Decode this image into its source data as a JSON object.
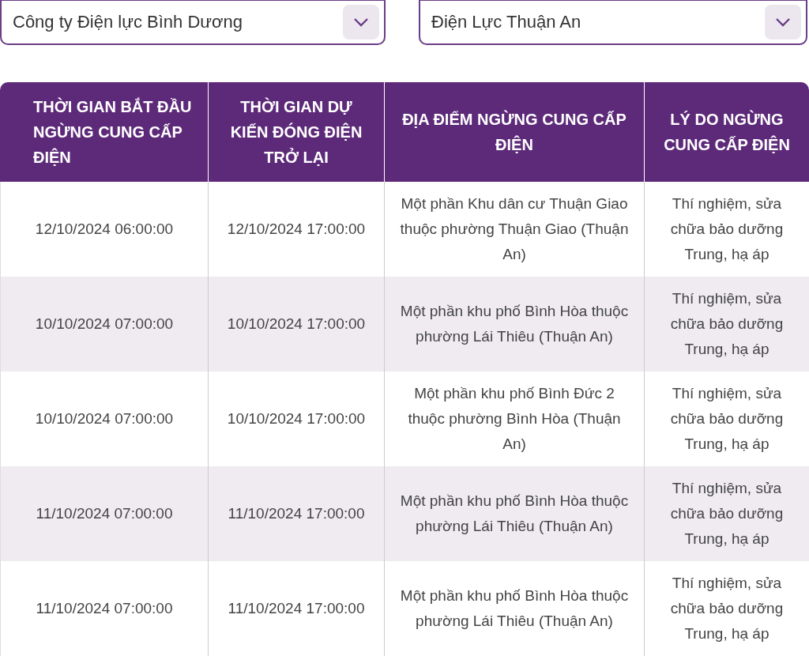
{
  "filters": [
    {
      "value": "Công ty Điện lực Bình Dương"
    },
    {
      "value": "Điện Lực Thuận An"
    }
  ],
  "table": {
    "columns": [
      "THỜI GIAN BẮT ĐẦU NGỪNG CUNG CẤP ĐIỆN",
      "THỜI GIAN DỰ KIẾN ĐÓNG ĐIỆN TRỞ LẠI",
      "ĐỊA ĐIỂM NGỪNG CUNG CẤP ĐIỆN",
      "LÝ DO NGỪNG CUNG CẤP ĐIỆN"
    ],
    "rows": [
      [
        "12/10/2024 06:00:00",
        "12/10/2024 17:00:00",
        "Một phần Khu dân cư Thuận Giao thuộc phường Thuận Giao (Thuận An)",
        "Thí nghiệm, sửa chữa bảo dưỡng Trung, hạ áp"
      ],
      [
        "10/10/2024 07:00:00",
        "10/10/2024 17:00:00",
        "Một phần khu phố Bình Hòa thuộc phường Lái Thiêu (Thuận An)",
        "Thí nghiệm, sửa chữa bảo dưỡng Trung, hạ áp"
      ],
      [
        "10/10/2024 07:00:00",
        "10/10/2024 17:00:00",
        "Một phần khu phố Bình Đức 2 thuộc phường Bình Hòa (Thuận An)",
        "Thí nghiệm, sửa chữa bảo dưỡng Trung, hạ áp"
      ],
      [
        "11/10/2024 07:00:00",
        "11/10/2024 17:00:00",
        "Một phần khu phố Bình Hòa thuộc phường Lái Thiêu (Thuận An)",
        "Thí nghiệm, sửa chữa bảo dưỡng Trung, hạ áp"
      ],
      [
        "11/10/2024 07:00:00",
        "11/10/2024 17:00:00",
        "Một phần khu phố Bình Hòa thuộc phường Lái Thiêu (Thuận An)",
        "Thí nghiệm, sửa chữa bảo dưỡng Trung, hạ áp"
      ]
    ]
  }
}
